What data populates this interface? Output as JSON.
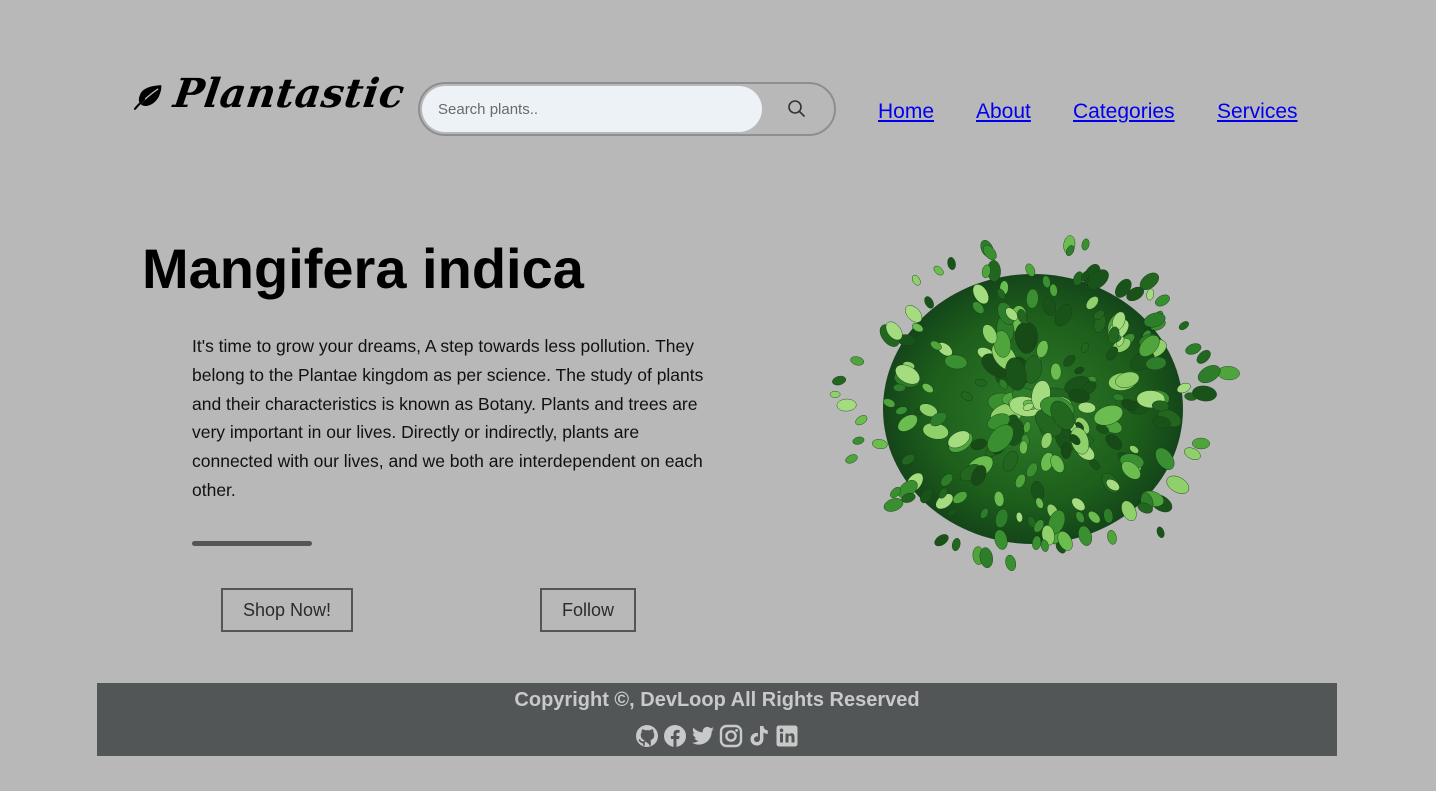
{
  "brand": {
    "name": "Plantastic",
    "logo_icon": "leaf-icon"
  },
  "search": {
    "placeholder": "Search plants..",
    "value": "",
    "icon": "search-icon"
  },
  "nav": {
    "items": [
      {
        "label": "Home"
      },
      {
        "label": "About"
      },
      {
        "label": "Categories"
      },
      {
        "label": "Services"
      }
    ]
  },
  "hero": {
    "title": "Mangifera indica",
    "description": "It's time to grow your dreams, A step towards less pollution. They belong to the Plantae kingdom as per science. The study of plants and their characteristics is known as Botany. Plants and trees are very important in our lives. Directly or indirectly, plants are connected with our lives, and we both are interdependent on each other.",
    "shop_label": "Shop Now!",
    "follow_label": "Follow",
    "image": "plant-image"
  },
  "footer": {
    "copyright": "Copyright ©, DevLoop All Rights Reserved",
    "socials": [
      "github-icon",
      "facebook-icon",
      "twitter-icon",
      "instagram-icon",
      "tiktok-icon",
      "linkedin-icon"
    ]
  },
  "colors": {
    "background": "#b8b8b8",
    "footer_bg": "#525656",
    "footer_text": "#c9c9c9",
    "search_bg": "#edf2f7",
    "text": "#000000"
  }
}
